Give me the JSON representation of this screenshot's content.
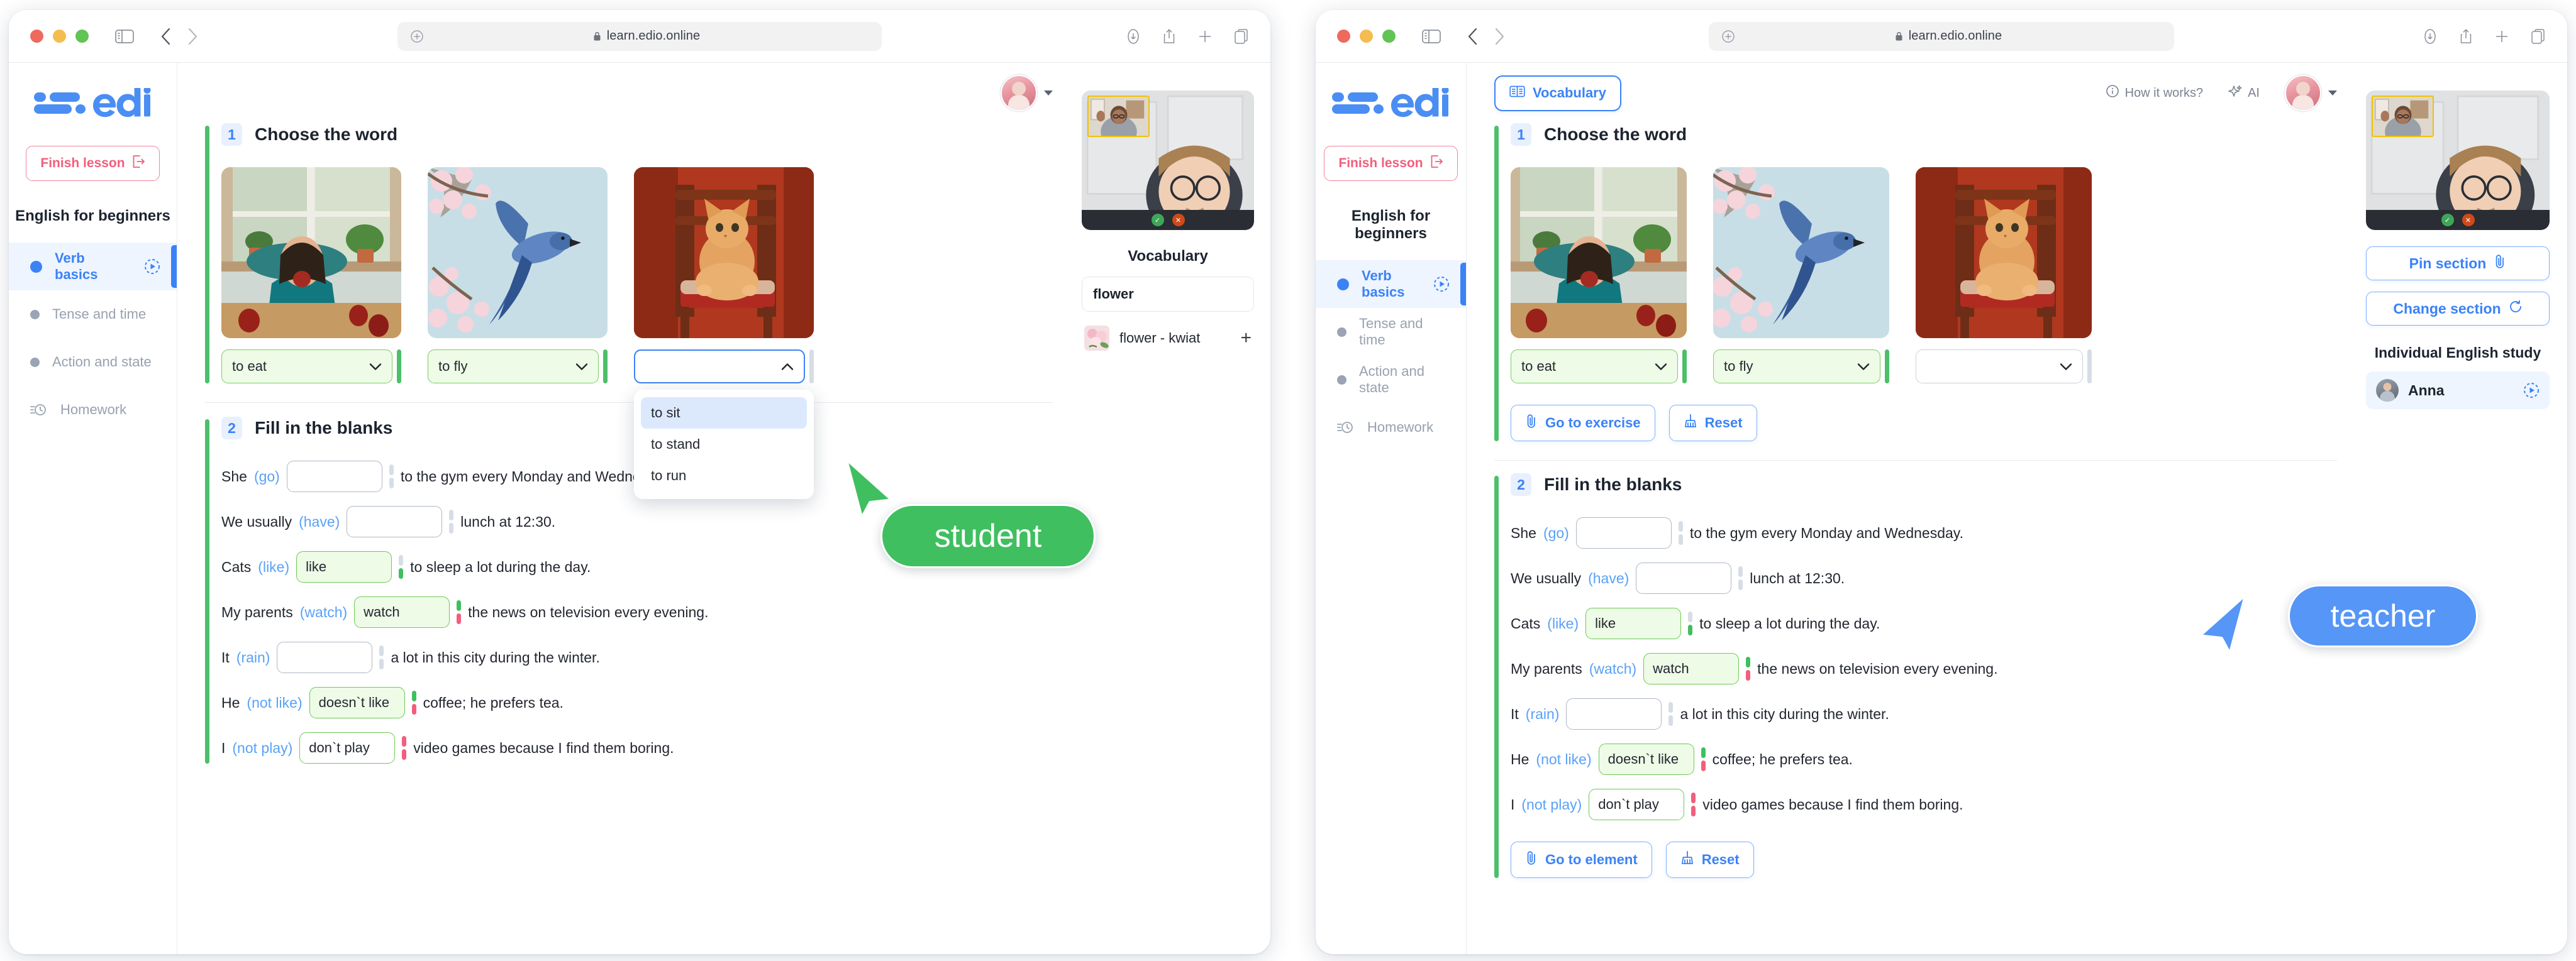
{
  "colors": {
    "brand_blue": "#3b82f6",
    "accent_green": "#4cbf6a",
    "danger_pink": "#f25e7c",
    "correct_bg": "#eefbe7",
    "active_nav_bg": "#eef5ff"
  },
  "browser": {
    "url": "learn.edio.online",
    "lock_icon": "lock-icon",
    "plus_icon": "plus-icon",
    "sidebar_icon": "sidebar-toggle-icon",
    "back_icon": "chevron-left-icon",
    "forward_icon": "chevron-right-icon",
    "download_icon": "download-icon",
    "share_icon": "share-icon",
    "newtab_icon": "plus-icon",
    "tabs_icon": "tabs-icon"
  },
  "student": {
    "role_label": "student",
    "sidebar": {
      "logo_text": "edio",
      "finish_label": "Finish lesson",
      "finish_icon": "exit-icon",
      "course_title": "English for beginners",
      "items": [
        {
          "label": "Verb basics",
          "icon": "bullet-icon",
          "end_icon": "play-progress-icon",
          "active": true
        },
        {
          "label": "Tense and time",
          "icon": "bullet-icon",
          "active": false
        },
        {
          "label": "Action and state",
          "icon": "bullet-icon",
          "active": false
        },
        {
          "label": "Homework",
          "icon": "homework-clock-icon",
          "active": false
        }
      ]
    },
    "exercise1": {
      "number": "1",
      "title": "Choose the word",
      "cards": [
        {
          "image": "woman-eating-apple",
          "value": "to eat",
          "state": "correct",
          "chevron": "chevron-down-icon"
        },
        {
          "image": "bird-flying-blossom",
          "value": "to fly",
          "state": "correct",
          "chevron": "chevron-down-icon"
        },
        {
          "image": "cat-on-chair",
          "value": "",
          "state": "open",
          "chevron": "chevron-up-icon"
        }
      ],
      "dropdown_options": [
        "to sit",
        "to stand",
        "to run"
      ],
      "dropdown_highlighted": "to sit"
    },
    "exercise2": {
      "number": "2",
      "title": "Fill in the blanks",
      "rows": [
        {
          "before": "She",
          "hint": "(go)",
          "value": "",
          "after": "to the gym every Monday and Wednesday.",
          "state": "empty",
          "ticks": [
            "grey",
            "grey"
          ]
        },
        {
          "before": "We usually",
          "hint": "(have)",
          "value": "",
          "after": "lunch at 12:30.",
          "state": "empty",
          "ticks": [
            "grey",
            "grey"
          ]
        },
        {
          "before": "Cats",
          "hint": "(like)",
          "value": "like",
          "after": "to sleep a lot during the day.",
          "state": "green",
          "ticks": [
            "grey",
            "green"
          ]
        },
        {
          "before": "My parents",
          "hint": "(watch)",
          "value": "watch",
          "after": "the news on television every evening.",
          "state": "green",
          "ticks": [
            "green",
            "red"
          ]
        },
        {
          "before": "It",
          "hint": "(rain)",
          "value": "",
          "after": "a lot in this city during the winter.",
          "state": "empty",
          "ticks": [
            "grey",
            "grey"
          ]
        },
        {
          "before": "He",
          "hint": "(not like)",
          "value": "doesn`t like",
          "after": "coffee; he prefers tea.",
          "state": "green",
          "ticks": [
            "green",
            "red"
          ]
        },
        {
          "before": "I",
          "hint": "(not play)",
          "value": "don`t play",
          "after": "video games because I find them boring.",
          "state": "white",
          "ticks": [
            "red",
            "red"
          ]
        }
      ]
    },
    "right_panel": {
      "vocabulary_title": "Vocabulary",
      "search_value": "flower",
      "entries": [
        {
          "label": "flower - kwiat",
          "add_icon": "plus-icon"
        }
      ]
    }
  },
  "teacher": {
    "role_label": "teacher",
    "sidebar": {
      "logo_text": "edio",
      "finish_label": "Finish lesson",
      "finish_icon": "exit-icon",
      "course_title": "English for beginners",
      "items": [
        {
          "label": "Verb basics",
          "icon": "bullet-icon",
          "end_icon": "play-progress-icon",
          "active": true
        },
        {
          "label": "Tense and time",
          "icon": "bullet-icon",
          "active": false
        },
        {
          "label": "Action and state",
          "icon": "bullet-icon",
          "active": false
        },
        {
          "label": "Homework",
          "icon": "homework-clock-icon",
          "active": false
        }
      ]
    },
    "topbar": {
      "vocabulary_label": "Vocabulary",
      "vocabulary_icon": "book-icon",
      "how_it_works_label": "How it works?",
      "how_it_works_icon": "info-icon",
      "ai_label": "AI",
      "ai_icon": "sparkle-icon",
      "avatar": "teacher-avatar"
    },
    "exercise1": {
      "number": "1",
      "title": "Choose the word",
      "cards": [
        {
          "image": "woman-eating-apple",
          "value": "to eat",
          "state": "correct",
          "chevron": "chevron-down-icon"
        },
        {
          "image": "bird-flying-blossom",
          "value": "to fly",
          "state": "correct",
          "chevron": "chevron-down-icon"
        },
        {
          "image": "cat-on-chair",
          "value": "",
          "state": "plain",
          "chevron": "chevron-down-icon"
        }
      ],
      "actions": [
        {
          "label": "Go to exercise",
          "icon": "paperclip-icon"
        },
        {
          "label": "Reset",
          "icon": "broom-icon"
        }
      ]
    },
    "exercise2": {
      "number": "2",
      "title": "Fill in the blanks",
      "rows": [
        {
          "before": "She",
          "hint": "(go)",
          "value": "",
          "after": "to the gym every Monday and Wednesday.",
          "state": "empty",
          "ticks": [
            "grey",
            "grey"
          ]
        },
        {
          "before": "We usually",
          "hint": "(have)",
          "value": "",
          "after": "lunch at 12:30.",
          "state": "empty",
          "ticks": [
            "grey",
            "grey"
          ]
        },
        {
          "before": "Cats",
          "hint": "(like)",
          "value": "like",
          "after": "to sleep a lot during the day.",
          "state": "green",
          "ticks": [
            "grey",
            "green"
          ]
        },
        {
          "before": "My parents",
          "hint": "(watch)",
          "value": "watch",
          "after": "the news on television every evening.",
          "state": "green",
          "ticks": [
            "green",
            "red"
          ]
        },
        {
          "before": "It",
          "hint": "(rain)",
          "value": "",
          "after": "a lot in this city during the winter.",
          "state": "empty",
          "ticks": [
            "grey",
            "grey"
          ]
        },
        {
          "before": "He",
          "hint": "(not like)",
          "value": "doesn`t like",
          "after": "coffee; he prefers tea.",
          "state": "green",
          "ticks": [
            "green",
            "red"
          ]
        },
        {
          "before": "I",
          "hint": "(not play)",
          "value": "don`t play",
          "after": "video games because I find them boring.",
          "state": "white",
          "ticks": [
            "red",
            "red"
          ]
        }
      ],
      "actions": [
        {
          "label": "Go to element",
          "icon": "paperclip-icon"
        },
        {
          "label": "Reset",
          "icon": "broom-icon"
        }
      ]
    },
    "right_panel": {
      "pin_label": "Pin section",
      "pin_icon": "paperclip-icon",
      "change_label": "Change section",
      "change_icon": "refresh-icon",
      "group_title": "Individual English study",
      "students": [
        {
          "name": "Anna",
          "end_icon": "play-progress-icon"
        }
      ]
    }
  }
}
